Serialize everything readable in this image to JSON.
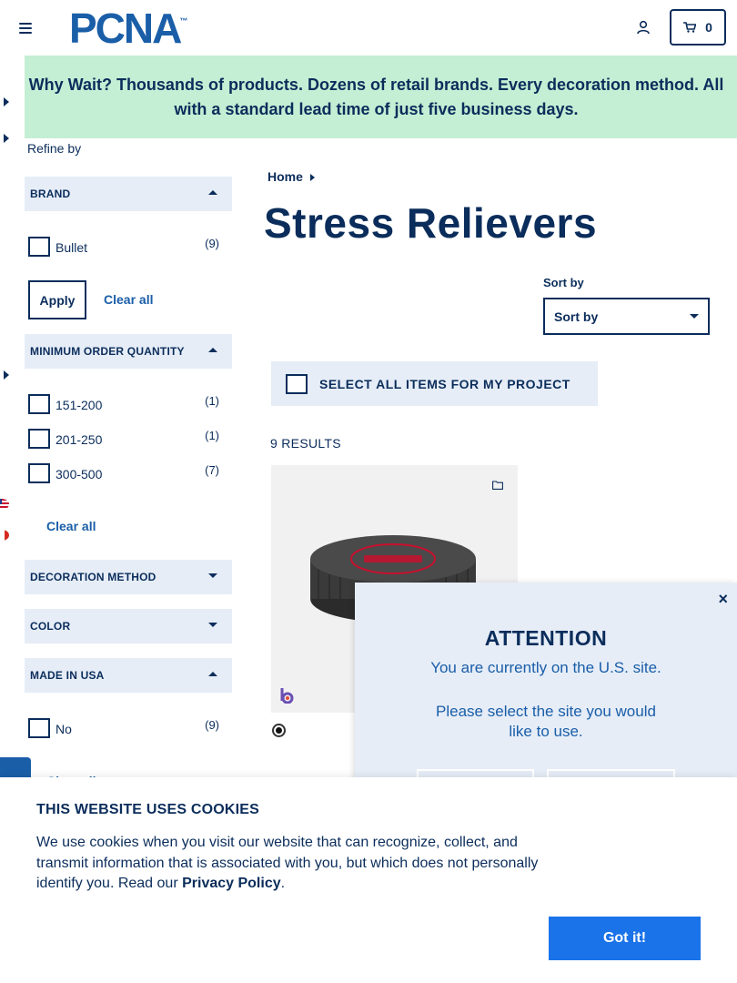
{
  "header": {
    "logo_text": "PCNA",
    "logo_tm": "™",
    "cart_count": "0"
  },
  "promo": {
    "text": "Why Wait? Thousands of products. Dozens of retail brands. Every decoration method. All with a standard lead time of just five business days."
  },
  "sidebar": {
    "refine_label": "Refine by",
    "facets": [
      {
        "title": "BRAND",
        "expanded": true,
        "options": [
          {
            "label": "Bullet",
            "count": "(9)"
          }
        ],
        "apply_label": "Apply",
        "clear_label": "Clear all"
      },
      {
        "title": "MINIMUM ORDER QUANTITY",
        "expanded": true,
        "options": [
          {
            "label": "151-200",
            "count": "(1)"
          },
          {
            "label": "201-250",
            "count": "(1)"
          },
          {
            "label": "300-500",
            "count": "(7)"
          }
        ],
        "clear_label": "Clear all"
      },
      {
        "title": "DECORATION METHOD",
        "expanded": false
      },
      {
        "title": "COLOR",
        "expanded": false
      },
      {
        "title": "MADE IN USA",
        "expanded": true,
        "options": [
          {
            "label": "No",
            "count": "(9)"
          }
        ],
        "clear_label": "Clear all"
      }
    ]
  },
  "main": {
    "breadcrumb_home": "Home",
    "title": "Stress Relievers",
    "sort_label": "Sort by",
    "sort_value": "Sort by",
    "select_all_label": "SELECT ALL ITEMS FOR MY PROJECT",
    "results_text": "9 RESULTS"
  },
  "modal": {
    "title": "ATTENTION",
    "line1": "You are currently on the U.S. site.",
    "line2": "Please select the site you would",
    "line3": "like to use.",
    "close": "×"
  },
  "cookie": {
    "title": "THIS WEBSITE USES COOKIES",
    "text": "We use cookies when you visit our website that can recognize, collect, and transmit information that is associated with you, but which does not personally identify you. Read our ",
    "link": "Privacy Policy",
    "period": ".",
    "button": "Got it!"
  },
  "colors": {
    "navy": "#0b2d5b",
    "brand_blue": "#1a5ea8",
    "promo_green": "#c4efd4",
    "panel_blue": "#e6edf7",
    "button_blue": "#1a73e8"
  }
}
